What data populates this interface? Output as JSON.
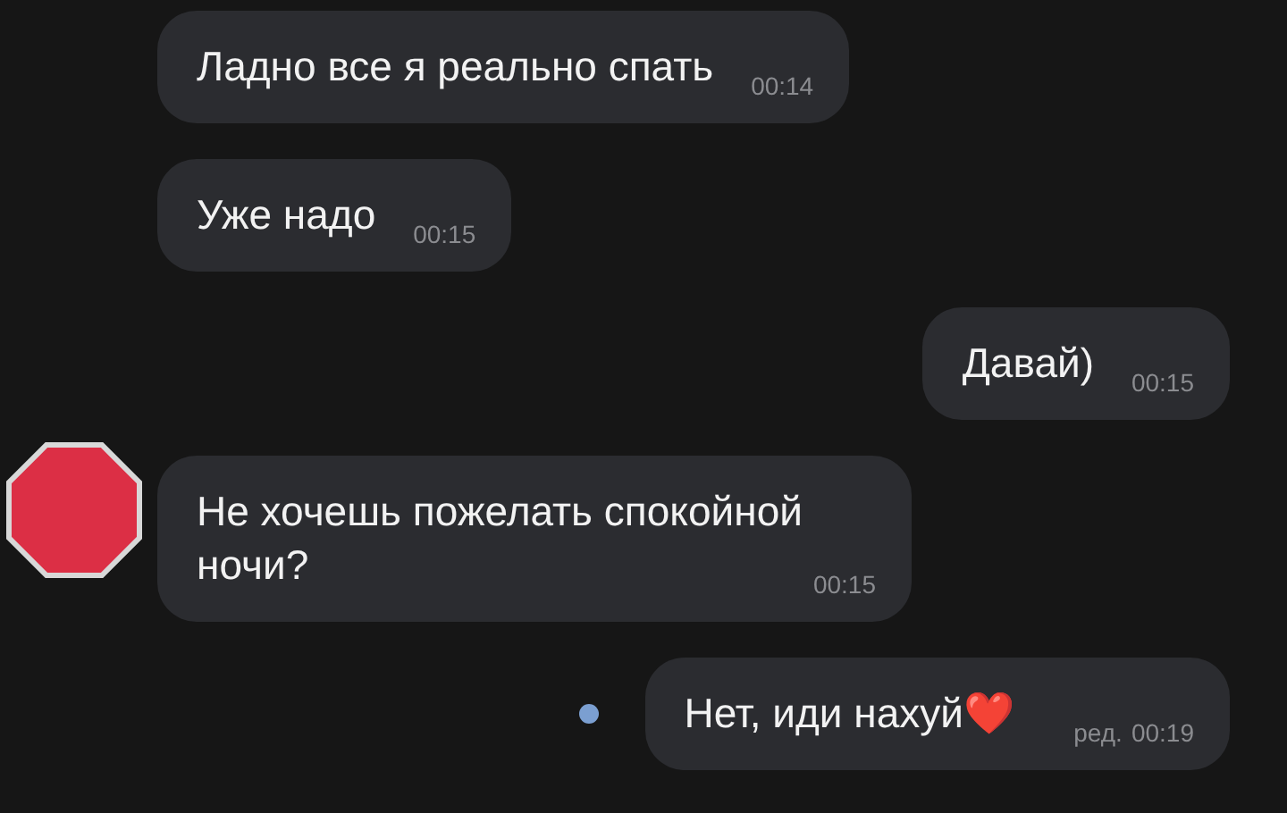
{
  "messages": [
    {
      "kind": "incoming",
      "text": "Ладно все я реально спать",
      "time": "00:14",
      "avatar": false,
      "unread": false
    },
    {
      "kind": "incoming",
      "text": "Уже надо",
      "time": "00:15",
      "avatar": false,
      "unread": false
    },
    {
      "kind": "outgoing",
      "text": "Давай)",
      "time": "00:15",
      "avatar": false,
      "unread": false
    },
    {
      "kind": "incoming",
      "text": "Не хочешь пожелать спокойной ночи?",
      "time": "00:15",
      "avatar": true,
      "unread": false
    },
    {
      "kind": "outgoing",
      "text": "Нет, иди нахуй❤️",
      "edited": "ред.",
      "time": "00:19",
      "avatar": false,
      "unread": true
    }
  ]
}
